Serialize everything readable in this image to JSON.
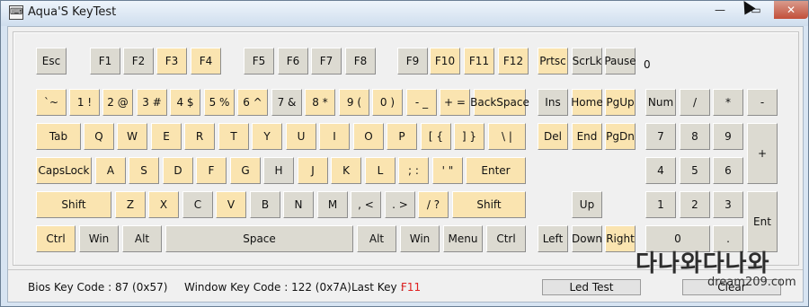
{
  "window": {
    "title": "Aqua'S KeyTest",
    "app_icon": "keyboard-icon"
  },
  "titlebar_buttons": {
    "minimize": "—",
    "maximize": "▭",
    "close": "✕"
  },
  "keyboard": {
    "lock_indicator": "0",
    "keys": [
      {
        "name": "esc",
        "label": "Esc",
        "c": "g"
      },
      {
        "name": "f1",
        "label": "F1",
        "c": "g"
      },
      {
        "name": "f2",
        "label": "F2",
        "c": "g"
      },
      {
        "name": "f3",
        "label": "F3",
        "c": "y"
      },
      {
        "name": "f4",
        "label": "F4",
        "c": "y"
      },
      {
        "name": "f5",
        "label": "F5",
        "c": "g"
      },
      {
        "name": "f6",
        "label": "F6",
        "c": "g"
      },
      {
        "name": "f7",
        "label": "F7",
        "c": "g"
      },
      {
        "name": "f8",
        "label": "F8",
        "c": "g"
      },
      {
        "name": "f9",
        "label": "F9",
        "c": "g"
      },
      {
        "name": "f10",
        "label": "F10",
        "c": "y"
      },
      {
        "name": "f11",
        "label": "F11",
        "c": "y"
      },
      {
        "name": "f12",
        "label": "F12",
        "c": "y"
      },
      {
        "name": "prtsc",
        "label": "Prtsc",
        "c": "y"
      },
      {
        "name": "scrlk",
        "label": "ScrLk",
        "c": "g"
      },
      {
        "name": "pause",
        "label": "Pause",
        "c": "g"
      },
      {
        "name": "backtick",
        "label": "`~",
        "c": "y"
      },
      {
        "name": "1",
        "label": "1 !",
        "c": "y"
      },
      {
        "name": "2",
        "label": "2 @",
        "c": "y"
      },
      {
        "name": "3",
        "label": "3 #",
        "c": "y"
      },
      {
        "name": "4",
        "label": "4 $",
        "c": "y"
      },
      {
        "name": "5",
        "label": "5 %",
        "c": "y"
      },
      {
        "name": "6",
        "label": "6 ^",
        "c": "y"
      },
      {
        "name": "7",
        "label": "7 &",
        "c": "g"
      },
      {
        "name": "8",
        "label": "8 *",
        "c": "y"
      },
      {
        "name": "9",
        "label": "9 (",
        "c": "y"
      },
      {
        "name": "0",
        "label": "0 )",
        "c": "y"
      },
      {
        "name": "minus",
        "label": "- _",
        "c": "y"
      },
      {
        "name": "equals",
        "label": "+ =",
        "c": "y"
      },
      {
        "name": "backspace",
        "label": "BackSpace",
        "c": "y"
      },
      {
        "name": "ins",
        "label": "Ins",
        "c": "g"
      },
      {
        "name": "home",
        "label": "Home",
        "c": "y"
      },
      {
        "name": "pgup",
        "label": "PgUp",
        "c": "y"
      },
      {
        "name": "num",
        "label": "Num",
        "c": "g"
      },
      {
        "name": "numdiv",
        "label": "/",
        "c": "g"
      },
      {
        "name": "nummul",
        "label": "*",
        "c": "g"
      },
      {
        "name": "numminus",
        "label": "-",
        "c": "g"
      },
      {
        "name": "tab",
        "label": "Tab",
        "c": "y"
      },
      {
        "name": "q",
        "label": "Q",
        "c": "y"
      },
      {
        "name": "w",
        "label": "W",
        "c": "y"
      },
      {
        "name": "e",
        "label": "E",
        "c": "y"
      },
      {
        "name": "r",
        "label": "R",
        "c": "y"
      },
      {
        "name": "t",
        "label": "T",
        "c": "y"
      },
      {
        "name": "y",
        "label": "Y",
        "c": "y"
      },
      {
        "name": "u",
        "label": "U",
        "c": "y"
      },
      {
        "name": "i",
        "label": "I",
        "c": "y"
      },
      {
        "name": "o",
        "label": "O",
        "c": "y"
      },
      {
        "name": "p",
        "label": "P",
        "c": "y"
      },
      {
        "name": "lbracket",
        "label": "[ {",
        "c": "y"
      },
      {
        "name": "rbracket",
        "label": "] }",
        "c": "y"
      },
      {
        "name": "backslash",
        "label": "\\ |",
        "c": "y"
      },
      {
        "name": "del",
        "label": "Del",
        "c": "y"
      },
      {
        "name": "end",
        "label": "End",
        "c": "y"
      },
      {
        "name": "pgdn",
        "label": "PgDn",
        "c": "y"
      },
      {
        "name": "num7",
        "label": "7",
        "c": "g"
      },
      {
        "name": "num8",
        "label": "8",
        "c": "g"
      },
      {
        "name": "num9",
        "label": "9",
        "c": "g"
      },
      {
        "name": "numplus",
        "label": "+",
        "c": "g"
      },
      {
        "name": "capslock",
        "label": "CapsLock",
        "c": "y"
      },
      {
        "name": "a",
        "label": "A",
        "c": "y"
      },
      {
        "name": "s",
        "label": "S",
        "c": "y"
      },
      {
        "name": "d",
        "label": "D",
        "c": "y"
      },
      {
        "name": "f",
        "label": "F",
        "c": "y"
      },
      {
        "name": "g",
        "label": "G",
        "c": "y"
      },
      {
        "name": "h",
        "label": "H",
        "c": "g"
      },
      {
        "name": "j",
        "label": "J",
        "c": "y"
      },
      {
        "name": "k",
        "label": "K",
        "c": "y"
      },
      {
        "name": "l",
        "label": "L",
        "c": "y"
      },
      {
        "name": "semicolon",
        "label": "; :",
        "c": "y"
      },
      {
        "name": "quote",
        "label": "' \"",
        "c": "y"
      },
      {
        "name": "enter",
        "label": "Enter",
        "c": "y"
      },
      {
        "name": "num4",
        "label": "4",
        "c": "g"
      },
      {
        "name": "num5",
        "label": "5",
        "c": "g"
      },
      {
        "name": "num6",
        "label": "6",
        "c": "g"
      },
      {
        "name": "lshift",
        "label": "Shift",
        "c": "y"
      },
      {
        "name": "z",
        "label": "Z",
        "c": "y"
      },
      {
        "name": "x",
        "label": "X",
        "c": "y"
      },
      {
        "name": "c",
        "label": "C",
        "c": "g"
      },
      {
        "name": "v",
        "label": "V",
        "c": "y"
      },
      {
        "name": "b",
        "label": "B",
        "c": "g"
      },
      {
        "name": "n",
        "label": "N",
        "c": "g"
      },
      {
        "name": "m",
        "label": "M",
        "c": "g"
      },
      {
        "name": "comma",
        "label": ", <",
        "c": "g"
      },
      {
        "name": "period",
        "label": ". >",
        "c": "g"
      },
      {
        "name": "slash",
        "label": "/ ?",
        "c": "y"
      },
      {
        "name": "rshift",
        "label": "Shift",
        "c": "y"
      },
      {
        "name": "up",
        "label": "Up",
        "c": "g"
      },
      {
        "name": "num1",
        "label": "1",
        "c": "g"
      },
      {
        "name": "num2",
        "label": "2",
        "c": "g"
      },
      {
        "name": "num3",
        "label": "3",
        "c": "g"
      },
      {
        "name": "numenter",
        "label": "Ent",
        "c": "g"
      },
      {
        "name": "lctrl",
        "label": "Ctrl",
        "c": "y"
      },
      {
        "name": "lwin",
        "label": "Win",
        "c": "g"
      },
      {
        "name": "lalt",
        "label": "Alt",
        "c": "g"
      },
      {
        "name": "space",
        "label": "Space",
        "c": "g"
      },
      {
        "name": "ralt",
        "label": "Alt",
        "c": "g"
      },
      {
        "name": "rwin",
        "label": "Win",
        "c": "g"
      },
      {
        "name": "menu",
        "label": "Menu",
        "c": "g"
      },
      {
        "name": "rctrl",
        "label": "Ctrl",
        "c": "g"
      },
      {
        "name": "left",
        "label": "Left",
        "c": "g"
      },
      {
        "name": "down",
        "label": "Down",
        "c": "g"
      },
      {
        "name": "right",
        "label": "Right",
        "c": "y"
      },
      {
        "name": "num0",
        "label": "0",
        "c": "g"
      },
      {
        "name": "numdot",
        "label": ".",
        "c": "g"
      }
    ]
  },
  "status": {
    "bios_key_code": "Bios Key Code : 87 (0x57)",
    "window_key_code": "Window Key Code : 122 (0x7A)",
    "last_key_label": "Last Key :",
    "last_key_value": "F11",
    "led_test_button": "Led Test",
    "clear_button": "Clear"
  },
  "watermark": {
    "text": "다나와다나와",
    "url": "dream209.com"
  },
  "colors": {
    "key_active": "#fae4b0",
    "key_inactive": "#dcdad1",
    "last_key": "#e02020"
  }
}
